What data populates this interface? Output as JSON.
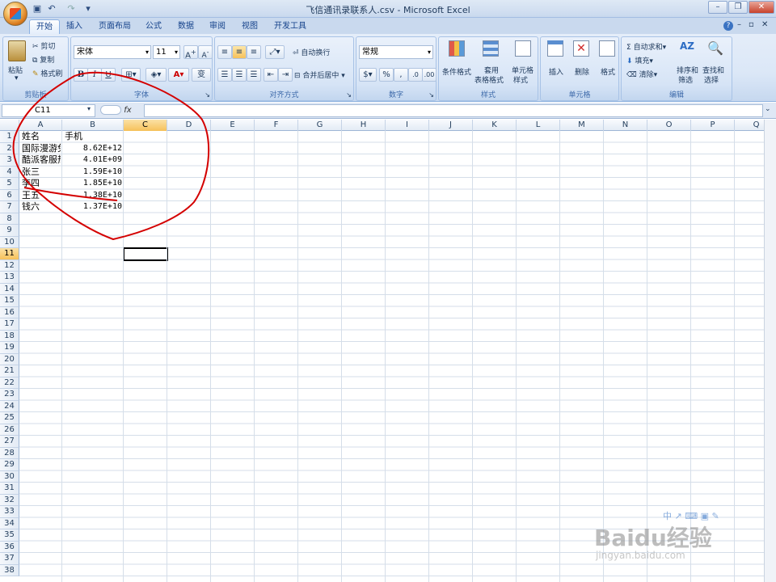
{
  "window": {
    "title": "飞信通讯录联系人.csv - Microsoft Excel"
  },
  "tabs": [
    "开始",
    "插入",
    "页面布局",
    "公式",
    "数据",
    "审阅",
    "视图",
    "开发工具"
  ],
  "ribbon": {
    "clipboard": {
      "paste": "粘贴",
      "cut": "剪切",
      "copy": "复制",
      "format_painter": "格式刷",
      "label": "剪贴板"
    },
    "font": {
      "name": "宋体",
      "size": "11",
      "bold": "B",
      "italic": "I",
      "underline": "U",
      "label": "字体",
      "fontcolor": "A",
      "wen": "变"
    },
    "align": {
      "wrap": "自动换行",
      "merge": "合并后居中",
      "label": "对齐方式"
    },
    "number": {
      "format": "常规",
      "percent": "%",
      "comma": ",",
      "label": "数字"
    },
    "styles": {
      "cond": "条件格式",
      "table1": "套用",
      "table2": "表格格式",
      "cell1": "单元格",
      "cell2": "样式",
      "label": "样式"
    },
    "cells": {
      "insert": "插入",
      "delete": "删除",
      "format": "格式",
      "label": "单元格"
    },
    "editing": {
      "autosum": "自动求和",
      "fill": "填充",
      "clear": "清除",
      "sort1": "排序和",
      "sort2": "筛选",
      "find1": "查找和",
      "find2": "选择",
      "label": "编辑"
    }
  },
  "formula_bar": {
    "name_box": "C11",
    "fx": "fx"
  },
  "columns": [
    "A",
    "B",
    "C",
    "D",
    "E",
    "F",
    "G",
    "H",
    "I",
    "J",
    "K",
    "L",
    "M",
    "N",
    "O",
    "P",
    "Q"
  ],
  "rows": [
    "1",
    "2",
    "3",
    "4",
    "5",
    "6",
    "7",
    "8",
    "9",
    "10",
    "11",
    "12",
    "13",
    "14",
    "15",
    "16",
    "17",
    "18",
    "19",
    "20",
    "21",
    "22",
    "23",
    "24",
    "25",
    "26",
    "27",
    "28",
    "29",
    "30",
    "31",
    "32",
    "33",
    "34",
    "35",
    "36",
    "37",
    "38"
  ],
  "sheet": {
    "header": {
      "a": "姓名",
      "b": "手机"
    },
    "data": [
      {
        "a": "国际漫游免",
        "b": "8.62E+12"
      },
      {
        "a": "酷派客服热",
        "b": "4.01E+09"
      },
      {
        "a": "张三",
        "b": "1.59E+10"
      },
      {
        "a": "李四",
        "b": "1.85E+10"
      },
      {
        "a": "王五",
        "b": "1.38E+10"
      },
      {
        "a": "钱六",
        "b": "1.37E+10"
      }
    ]
  },
  "watermark": {
    "brand": "Baidu经验",
    "url": "jingyan.baidu.com"
  },
  "colors": {
    "annotation": "#d40000",
    "selection": "#f6c15a"
  }
}
